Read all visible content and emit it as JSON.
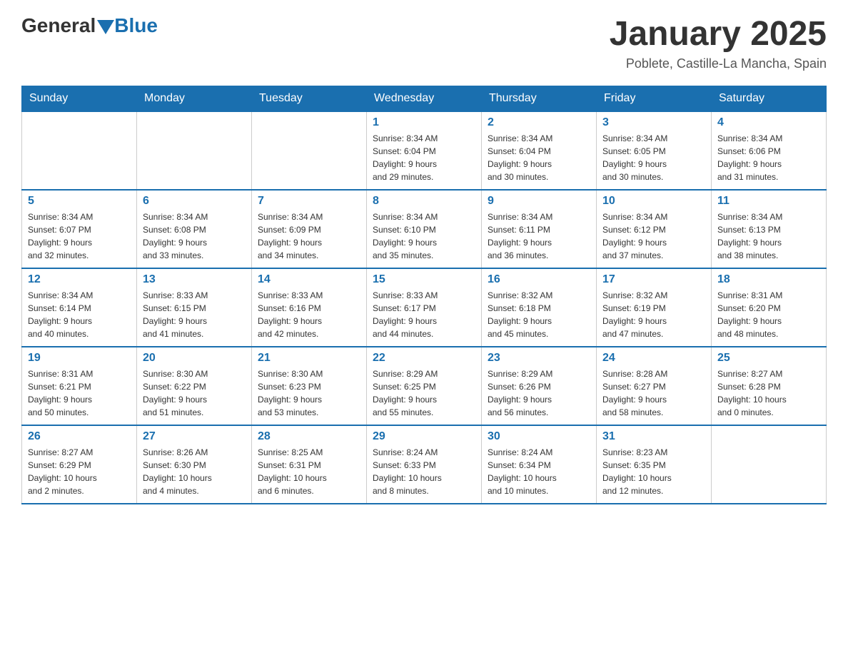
{
  "header": {
    "logo": {
      "general": "General",
      "triangle": "▶",
      "blue": "Blue"
    },
    "title": "January 2025",
    "location": "Poblete, Castille-La Mancha, Spain"
  },
  "weekdays": [
    "Sunday",
    "Monday",
    "Tuesday",
    "Wednesday",
    "Thursday",
    "Friday",
    "Saturday"
  ],
  "weeks": [
    [
      {
        "day": "",
        "info": ""
      },
      {
        "day": "",
        "info": ""
      },
      {
        "day": "",
        "info": ""
      },
      {
        "day": "1",
        "info": "Sunrise: 8:34 AM\nSunset: 6:04 PM\nDaylight: 9 hours\nand 29 minutes."
      },
      {
        "day": "2",
        "info": "Sunrise: 8:34 AM\nSunset: 6:04 PM\nDaylight: 9 hours\nand 30 minutes."
      },
      {
        "day": "3",
        "info": "Sunrise: 8:34 AM\nSunset: 6:05 PM\nDaylight: 9 hours\nand 30 minutes."
      },
      {
        "day": "4",
        "info": "Sunrise: 8:34 AM\nSunset: 6:06 PM\nDaylight: 9 hours\nand 31 minutes."
      }
    ],
    [
      {
        "day": "5",
        "info": "Sunrise: 8:34 AM\nSunset: 6:07 PM\nDaylight: 9 hours\nand 32 minutes."
      },
      {
        "day": "6",
        "info": "Sunrise: 8:34 AM\nSunset: 6:08 PM\nDaylight: 9 hours\nand 33 minutes."
      },
      {
        "day": "7",
        "info": "Sunrise: 8:34 AM\nSunset: 6:09 PM\nDaylight: 9 hours\nand 34 minutes."
      },
      {
        "day": "8",
        "info": "Sunrise: 8:34 AM\nSunset: 6:10 PM\nDaylight: 9 hours\nand 35 minutes."
      },
      {
        "day": "9",
        "info": "Sunrise: 8:34 AM\nSunset: 6:11 PM\nDaylight: 9 hours\nand 36 minutes."
      },
      {
        "day": "10",
        "info": "Sunrise: 8:34 AM\nSunset: 6:12 PM\nDaylight: 9 hours\nand 37 minutes."
      },
      {
        "day": "11",
        "info": "Sunrise: 8:34 AM\nSunset: 6:13 PM\nDaylight: 9 hours\nand 38 minutes."
      }
    ],
    [
      {
        "day": "12",
        "info": "Sunrise: 8:34 AM\nSunset: 6:14 PM\nDaylight: 9 hours\nand 40 minutes."
      },
      {
        "day": "13",
        "info": "Sunrise: 8:33 AM\nSunset: 6:15 PM\nDaylight: 9 hours\nand 41 minutes."
      },
      {
        "day": "14",
        "info": "Sunrise: 8:33 AM\nSunset: 6:16 PM\nDaylight: 9 hours\nand 42 minutes."
      },
      {
        "day": "15",
        "info": "Sunrise: 8:33 AM\nSunset: 6:17 PM\nDaylight: 9 hours\nand 44 minutes."
      },
      {
        "day": "16",
        "info": "Sunrise: 8:32 AM\nSunset: 6:18 PM\nDaylight: 9 hours\nand 45 minutes."
      },
      {
        "day": "17",
        "info": "Sunrise: 8:32 AM\nSunset: 6:19 PM\nDaylight: 9 hours\nand 47 minutes."
      },
      {
        "day": "18",
        "info": "Sunrise: 8:31 AM\nSunset: 6:20 PM\nDaylight: 9 hours\nand 48 minutes."
      }
    ],
    [
      {
        "day": "19",
        "info": "Sunrise: 8:31 AM\nSunset: 6:21 PM\nDaylight: 9 hours\nand 50 minutes."
      },
      {
        "day": "20",
        "info": "Sunrise: 8:30 AM\nSunset: 6:22 PM\nDaylight: 9 hours\nand 51 minutes."
      },
      {
        "day": "21",
        "info": "Sunrise: 8:30 AM\nSunset: 6:23 PM\nDaylight: 9 hours\nand 53 minutes."
      },
      {
        "day": "22",
        "info": "Sunrise: 8:29 AM\nSunset: 6:25 PM\nDaylight: 9 hours\nand 55 minutes."
      },
      {
        "day": "23",
        "info": "Sunrise: 8:29 AM\nSunset: 6:26 PM\nDaylight: 9 hours\nand 56 minutes."
      },
      {
        "day": "24",
        "info": "Sunrise: 8:28 AM\nSunset: 6:27 PM\nDaylight: 9 hours\nand 58 minutes."
      },
      {
        "day": "25",
        "info": "Sunrise: 8:27 AM\nSunset: 6:28 PM\nDaylight: 10 hours\nand 0 minutes."
      }
    ],
    [
      {
        "day": "26",
        "info": "Sunrise: 8:27 AM\nSunset: 6:29 PM\nDaylight: 10 hours\nand 2 minutes."
      },
      {
        "day": "27",
        "info": "Sunrise: 8:26 AM\nSunset: 6:30 PM\nDaylight: 10 hours\nand 4 minutes."
      },
      {
        "day": "28",
        "info": "Sunrise: 8:25 AM\nSunset: 6:31 PM\nDaylight: 10 hours\nand 6 minutes."
      },
      {
        "day": "29",
        "info": "Sunrise: 8:24 AM\nSunset: 6:33 PM\nDaylight: 10 hours\nand 8 minutes."
      },
      {
        "day": "30",
        "info": "Sunrise: 8:24 AM\nSunset: 6:34 PM\nDaylight: 10 hours\nand 10 minutes."
      },
      {
        "day": "31",
        "info": "Sunrise: 8:23 AM\nSunset: 6:35 PM\nDaylight: 10 hours\nand 12 minutes."
      },
      {
        "day": "",
        "info": ""
      }
    ]
  ]
}
